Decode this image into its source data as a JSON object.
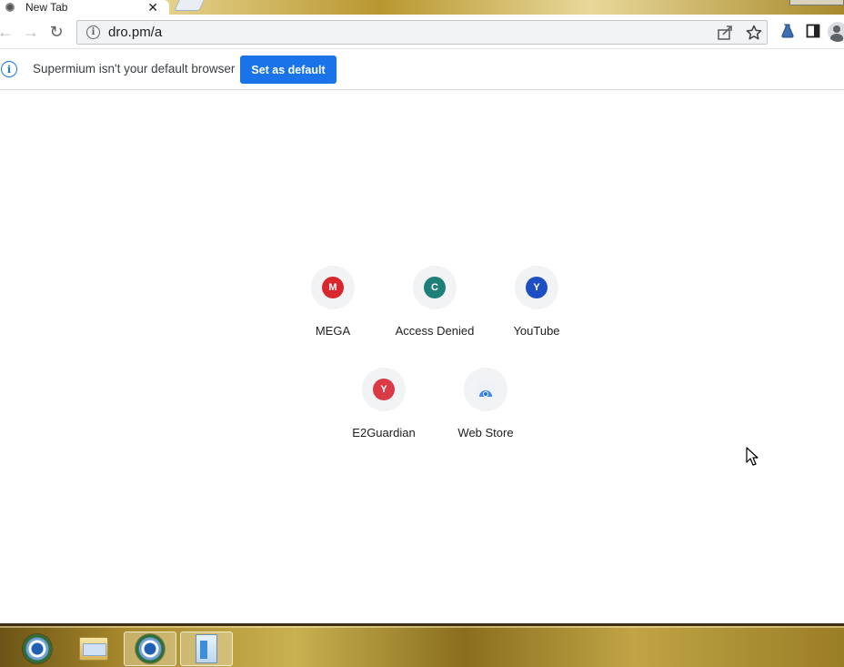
{
  "tab": {
    "title": "New Tab",
    "close_glyph": "✕"
  },
  "toolbar": {
    "back_glyph": "←",
    "forward_glyph": "→",
    "reload_glyph": "↻",
    "url": "dro.pm/a",
    "info_glyph": "i"
  },
  "infobar": {
    "info_glyph": "i",
    "message": "Supermium isn't your default browser",
    "button_label": "Set as default"
  },
  "shortcuts": [
    {
      "label": "MEGA",
      "letter": "M",
      "color": "#d9272e"
    },
    {
      "label": "Access Denied",
      "letter": "C",
      "color": "#1e7f78"
    },
    {
      "label": "YouTube",
      "letter": "Y",
      "color": "#1e4fc2"
    },
    {
      "label": "E2Guardian",
      "letter": "Y",
      "color": "#d93a44"
    },
    {
      "label": "Web Store",
      "letter": "",
      "color": "#4285f4"
    }
  ],
  "taskbar": {
    "items": [
      "chrome-app-icon",
      "folder-app-icon",
      "chrome-app-icon",
      "document-app-icon"
    ]
  },
  "colors": {
    "accent": "#1a73e8"
  }
}
